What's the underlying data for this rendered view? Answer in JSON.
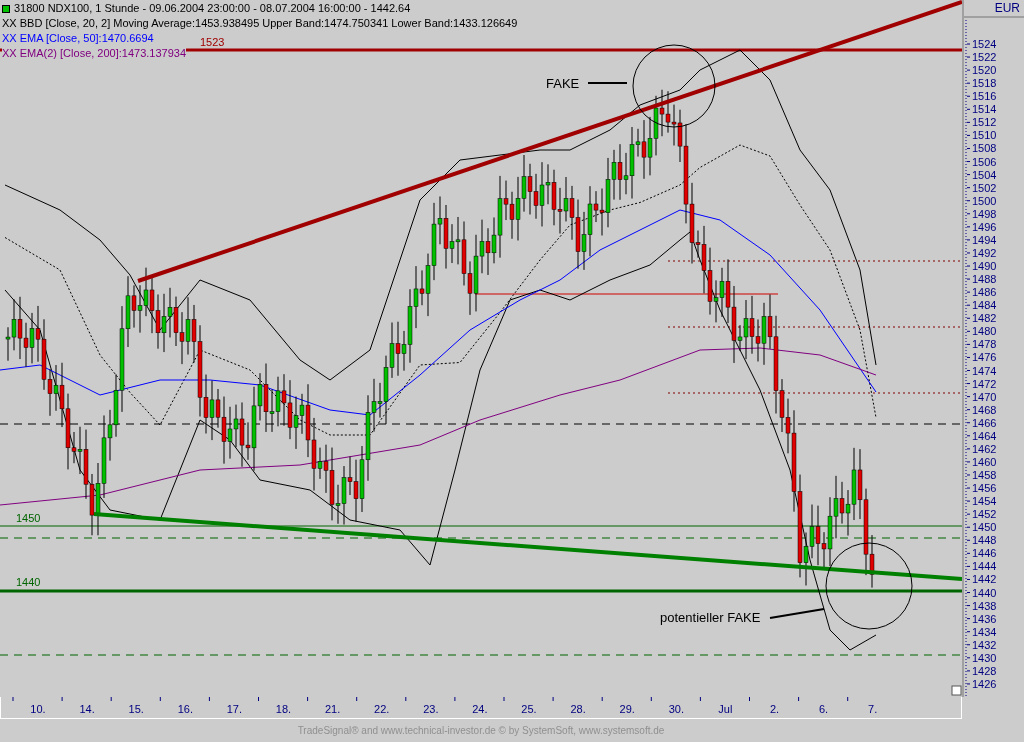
{
  "header": {
    "title": "31800  NDX100, 1 Stunde - 09.06.2004 23:00:00 - 08.07.2004 16:00:00 - 1442.64",
    "indicators": [
      {
        "text": "XX BBD [Close, 20, 2] Moving Average:1453.938495 Upper Band:1474.750341 Lower Band:1433.126649",
        "color": "#000000"
      },
      {
        "text": "XX EMA [Close, 50]:1470.6694",
        "color": "#0000ff"
      },
      {
        "text": "XX EMA(2) [Close, 200]:1473.137934",
        "color": "#800080"
      }
    ]
  },
  "currency": "EUR",
  "price_axis": [
    "1524",
    "1522",
    "1520",
    "1518",
    "1516",
    "1514",
    "1512",
    "1510",
    "1508",
    "1506",
    "1504",
    "1502",
    "1500",
    "1498",
    "1496",
    "1494",
    "1492",
    "1490",
    "1488",
    "1486",
    "1484",
    "1482",
    "1480",
    "1478",
    "1476",
    "1474",
    "1472",
    "1470",
    "1468",
    "1466",
    "1464",
    "1462",
    "1460",
    "1458",
    "1456",
    "1454",
    "1452",
    "1450",
    "1448",
    "1446",
    "1444",
    "1442",
    "1440",
    "1438",
    "1436",
    "1434",
    "1432",
    "1430",
    "1428",
    "1426"
  ],
  "time_axis": [
    "10.",
    "14.",
    "15.",
    "16.",
    "17.",
    "18.",
    "21.",
    "22.",
    "23.",
    "24.",
    "25.",
    "28.",
    "29.",
    "30.",
    "Jul",
    "2.",
    "6.",
    "7."
  ],
  "levels": [
    {
      "label": "1523",
      "color": "#a00000"
    },
    {
      "label": "1450",
      "color": "#006400"
    },
    {
      "label": "1440",
      "color": "#006400"
    }
  ],
  "annotations": [
    {
      "text": "FAKE"
    },
    {
      "text": "potentieller FAKE"
    }
  ],
  "footer": "TradeSignal® and www.technical-investor.de © by  SystemSoft, www.systemsoft.de"
}
